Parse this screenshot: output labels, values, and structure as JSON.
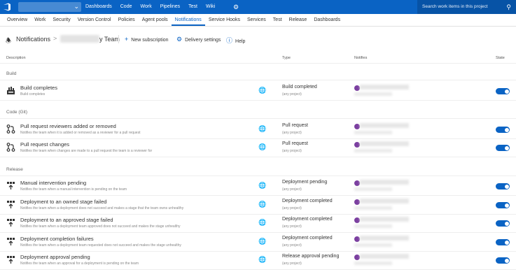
{
  "topbar": {
    "nav": [
      "Dashboards",
      "Code",
      "Work",
      "Pipelines",
      "Test",
      "Wiki"
    ],
    "search_placeholder": "Search work items in this project"
  },
  "subnav": {
    "items": [
      "Overview",
      "Work",
      "Security",
      "Version Control",
      "Policies",
      "Agent pools",
      "Notifications",
      "Service Hooks",
      "Services",
      "Test",
      "Release",
      "Dashboards"
    ],
    "active": "Notifications"
  },
  "header": {
    "title": "Notifications",
    "separator": ">",
    "team": "y Team",
    "new_subscription": "New subscription",
    "delivery_settings": "Delivery settings",
    "help": "Help"
  },
  "columns": {
    "description": "Description",
    "type": "Type",
    "notifies": "Notifies",
    "state": "State"
  },
  "groups": [
    {
      "name": "Build",
      "rows": [
        {
          "icon": "build-icon",
          "title": "Build completes",
          "desc": "Build completes",
          "type": "Build completed",
          "project": "(any project)",
          "notifies_suffix": "In",
          "state": "on"
        }
      ]
    },
    {
      "name": "Code (Git)",
      "rows": [
        {
          "icon": "pull-request-icon",
          "title": "Pull request reviewers added or removed",
          "desc": "Notifies the team when it is added or removed as a reviewer for a pull request",
          "type": "Pull request",
          "project": "(any project)",
          "notifies_suffix": "In",
          "state": "on"
        },
        {
          "icon": "pull-request-icon",
          "title": "Pull request changes",
          "desc": "Notifies the team when changes are made to a pull request the team is a reviewer for",
          "type": "Pull request",
          "project": "(any project)",
          "notifies_suffix": "In",
          "state": "on"
        }
      ]
    },
    {
      "name": "Release",
      "rows": [
        {
          "icon": "release-icon",
          "title": "Manual intervention pending",
          "desc": "Notifies the team when a manual intervention is pending on the team",
          "type": "Deployment pending",
          "project": "(any project)",
          "notifies_suffix": "In",
          "state": "on"
        },
        {
          "icon": "release-icon",
          "title": "Deployment to an owned stage failed",
          "desc": "Notifies the team when a deployment does not succeed and makes a stage that the team owns unhealthy",
          "type": "Deployment completed",
          "project": "(any project)",
          "notifies_suffix": "In",
          "state": "on"
        },
        {
          "icon": "release-icon",
          "title": "Deployment to an approved stage failed",
          "desc": "Notifies the team when a deployment team approved does not succeed and makes the stage unhealthy",
          "type": "Deployment completed",
          "project": "(any project)",
          "notifies_suffix": "In",
          "state": "on"
        },
        {
          "icon": "release-icon",
          "title": "Deployment completion failures",
          "desc": "Notifies the team when a deployment team requested does not succeed and makes the stage unhealthy",
          "type": "Deployment completed",
          "project": "(any project)",
          "notifies_suffix": "In",
          "state": "on"
        },
        {
          "icon": "release-icon",
          "title": "Deployment approval pending",
          "desc": "Notifies the team when an approval for a deployment is pending on the team",
          "type": "Release approval pending",
          "project": "(any project)",
          "notifies_suffix": "In",
          "state": "on"
        }
      ]
    }
  ],
  "colors": {
    "accent": "#0a63c4",
    "avatar": "#7b3fa0"
  }
}
